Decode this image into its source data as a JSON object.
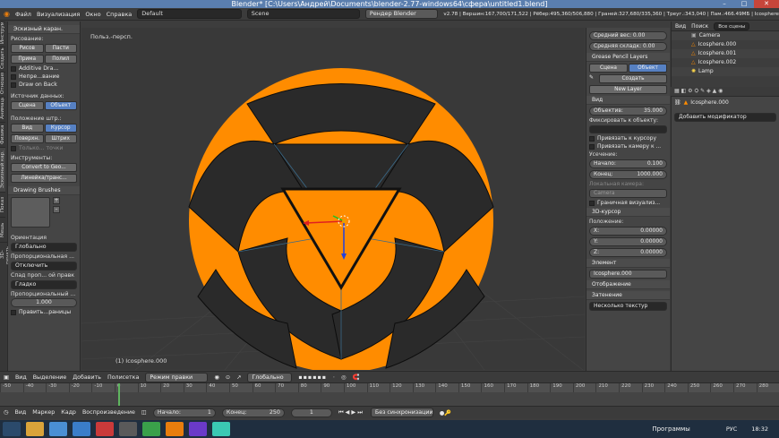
{
  "window": {
    "title": "Blender* [C:\\Users\\Андрей\\Documents\\blender-2.77-windows64\\сфера\\untitled1.blend]",
    "min": "–",
    "max": "□",
    "close": "✕"
  },
  "info_header": {
    "menus": [
      "Файл",
      "Визуализация",
      "Окно",
      "Справка"
    ],
    "layout": "Default",
    "scene": "Scene",
    "engine": "Рендер Blender",
    "stats": "v2.78 | Вершин:167,700/171,522 | Рёбер:495,360/506,880 | Граней:327,680/335,360 | Треуг.:343,040 | Пам.:466.49МБ | Icosphere"
  },
  "left_tabs": [
    "Инструменты",
    "Создать",
    "Отношения",
    "Анимация",
    "Физика",
    "Эскизный кар.",
    "Показ",
    "Мешь",
    "3D-печать"
  ],
  "tool_shelf": {
    "panel1": "Эскизный каран.",
    "draw_label": "Рисование:",
    "draw_btns": [
      "Рисов",
      "Пасти",
      "Прима",
      "Полил"
    ],
    "additive": "Additive Dra...",
    "continuous": "Непре...вание",
    "draw_back": "Draw on Back",
    "data_source": "Источник данных:",
    "scene_btn": "Сцена",
    "object_btn": "Объект",
    "stroke_pos": "Положение штр.:",
    "view_btn": "Вид",
    "cursor_btn": "Курсор",
    "surface_btn": "Поверхн.",
    "stroke_btn": "Штрих",
    "only_points": "Только... точки",
    "tools_label": "Инструменты:",
    "convert": "Convert to Geo...",
    "ruler": "Линейка/транс...",
    "brushes_panel": "Drawing Brushes",
    "orientation_label": "Ориентация",
    "orientation": "Глобально",
    "prop_label": "Пропорциональная ...",
    "prop_value": "Отключить",
    "falloff_label": "Спад проп... ой правк",
    "falloff": "Гладко",
    "prop_size_label": "Пропорциональный ...",
    "prop_size": "1.000",
    "edit_label": "Править...раницы"
  },
  "viewport": {
    "label": "Польз.-персп.",
    "object_label": "(1) Icosphere.000"
  },
  "n_panel": {
    "weight": "Средний вес: 0.00",
    "crease": "Средняя складк: 0.00",
    "gp_layers": "Grease Pencil Layers",
    "scene_tab": "Сцена",
    "object_tab": "Объект",
    "create": "Создать",
    "new_layer": "New Layer",
    "view_panel": "Вид",
    "lens_label": "Объектив:",
    "lens_value": "35.000",
    "lock_label": "Фиксировать к объекту:",
    "lock_cursor": "Привязать к курсору",
    "lock_camera": "Привязать камеру к ...",
    "clip_label": "Усечение:",
    "clip_start_label": "Начало:",
    "clip_start": "0.100",
    "clip_end_label": "Конец:",
    "clip_end": "1000.000",
    "local_camera": "Локальная камера:",
    "camera": "Camera",
    "render_border": "Граничная визуализ...",
    "cursor_panel": "3D-курсор",
    "location": "Положение:",
    "x_label": "X:",
    "x": "0.00000",
    "y_label": "Y:",
    "y": "0.00000",
    "z_label": "Z:",
    "z": "0.00000",
    "item_panel": "Элемент",
    "item_name": "Icosphere.000",
    "display_panel": "Отображение",
    "shading_panel": "Затенение",
    "shading_value": "Несколько текстур"
  },
  "outliner": {
    "view": "Вид",
    "search": "Поиск",
    "scenes": "Все сцены",
    "items": [
      "Camera",
      "Icosphere.000",
      "Icosphere.001",
      "Icosphere.002",
      "Lamp"
    ]
  },
  "properties": {
    "object": "Icosphere.000",
    "add_modifier": "Добавить модификатор"
  },
  "view_header": {
    "menus": [
      "Вид",
      "Выделение",
      "Добавить",
      "Полисетка"
    ],
    "mode": "Режим правки",
    "orientation": "Глобально"
  },
  "timeline": {
    "ticks": [
      "-50",
      "-40",
      "-30",
      "-20",
      "-10",
      "0",
      "10",
      "20",
      "30",
      "40",
      "50",
      "60",
      "70",
      "80",
      "90",
      "100",
      "110",
      "120",
      "130",
      "140",
      "150",
      "160",
      "170",
      "180",
      "190",
      "200",
      "210",
      "220",
      "230",
      "240",
      "250",
      "260",
      "270",
      "280"
    ],
    "menus": [
      "Вид",
      "Маркер",
      "Кадр",
      "Воспроизведение"
    ],
    "start_label": "Начало:",
    "start": "1",
    "end_label": "Конец:",
    "end": "250",
    "current": "1",
    "sync": "Без синхронизации"
  },
  "taskbar": {
    "programs": "Программы",
    "lang": "РУС",
    "time": "18:32"
  },
  "colors": {
    "accent": "#5680c2",
    "orange": "#ff8c00",
    "title": "#5a7eae"
  }
}
